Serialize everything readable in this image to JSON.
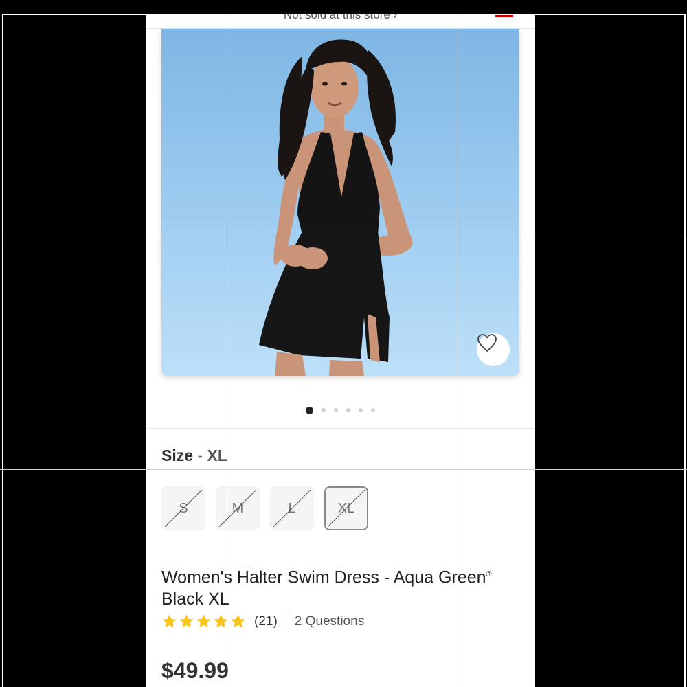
{
  "store": {
    "notice": "Not sold at this store ›"
  },
  "gallery": {
    "slides": 6,
    "active_index": 0
  },
  "size": {
    "label": "Size",
    "separator": "-",
    "selected": "XL",
    "options": [
      "S",
      "M",
      "L",
      "XL"
    ]
  },
  "product": {
    "title_line1": "Women's Halter Swim Dress - Aqua Green",
    "title_reg": "®",
    "title_line2": "Black XL",
    "rating_stars": 5,
    "rating_count": "(21)",
    "questions": "2 Questions",
    "price": "$49.99"
  },
  "colors": {
    "star": "#f5c518",
    "brand_red": "#cc0000"
  },
  "icons": {
    "favorite": "heart-outline-icon",
    "rating": "star-icon"
  }
}
